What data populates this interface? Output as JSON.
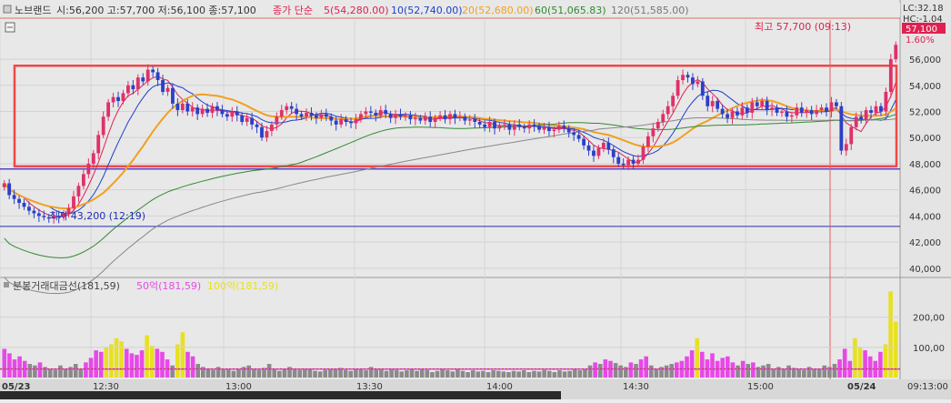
{
  "header": {
    "stock_name": "노브랜드",
    "ohlc_text": "시:56,200 고:57,700 저:56,100 종:57,100",
    "ma_title": "종가 단순",
    "ma5": "5(54,280.00)",
    "ma10": "10(52,740.00)",
    "ma20": "20(52,680.00)",
    "ma60": "60(51,065.83)",
    "ma120": "120(51,585.00)"
  },
  "side_labels": {
    "lc": "LC:32.18",
    "hc": "HC:-1.04",
    "last_price": "57,100",
    "change_pct": "1.60%"
  },
  "annotations": {
    "high": "최고 57,700 (09:13)",
    "low": "최저 43,200 (12:19)"
  },
  "volume_header": {
    "title": "분봉거래대금선(181,59)",
    "ma50": "50억(181,59)",
    "ma100": "100억(181,59)"
  },
  "time_axis": {
    "labels": [
      "05/23",
      "12:30",
      "13:00",
      "13:30",
      "14:00",
      "14:30",
      "15:00",
      "05/24"
    ],
    "right_label": "09:13:00"
  },
  "colors": {
    "up": "#e0306a",
    "down": "#2a40c8",
    "ma5": "#e02050",
    "ma10": "#2040c8",
    "ma20": "#f0a020",
    "ma60": "#308a30",
    "ma120": "#888888",
    "box": "#f04848",
    "support": "#6040c0",
    "low_line": "#2030b0",
    "vol_up": "#e8e020",
    "vol_spike": "#e848e8",
    "vol_base": "#8a8a8a"
  },
  "chart_data": [
    {
      "type": "candlestick",
      "title": "",
      "ylim": [
        39500,
        59000
      ],
      "y_ticks": [
        40000,
        42000,
        44000,
        46000,
        48000,
        50000,
        52000,
        54000,
        56000
      ],
      "y_tick_labels": [
        "40,000",
        "42,000",
        "44,000",
        "46,000",
        "48,000",
        "50,000",
        "52,000",
        "54,000",
        "56,000"
      ],
      "close_series": [
        46500,
        45600,
        45300,
        45000,
        44700,
        44400,
        44200,
        44000,
        43900,
        43800,
        44000,
        43900,
        44200,
        44600,
        45500,
        46300,
        47200,
        48000,
        48800,
        50200,
        51600,
        52700,
        53100,
        52800,
        53400,
        54000,
        53700,
        54600,
        54300,
        55200,
        55000,
        54400,
        53500,
        53800,
        52600,
        52100,
        52600,
        52000,
        52300,
        51800,
        52200,
        51900,
        52400,
        52100,
        51800,
        51600,
        52000,
        51700,
        51200,
        51500,
        51000,
        50800,
        50000,
        50500,
        51000,
        51600,
        52100,
        52400,
        52200,
        51800,
        51600,
        51900,
        51700,
        51500,
        51800,
        51600,
        51300,
        51000,
        51400,
        51200,
        51100,
        51400,
        51800,
        52000,
        51900,
        51700,
        52100,
        51800,
        51500,
        51800,
        51600,
        51700,
        51400,
        51500,
        51300,
        51600,
        51200,
        51500,
        51700,
        51400,
        51800,
        51500,
        51600,
        51300,
        51400,
        51200,
        51000,
        50800,
        51200,
        50700,
        50900,
        51000,
        50600,
        51000,
        50800,
        50700,
        51000,
        50900,
        50600,
        50800,
        50500,
        50600,
        50900,
        50700,
        50400,
        50200,
        49900,
        49400,
        49000,
        48600,
        49200,
        49600,
        49100,
        48500,
        48000,
        47900,
        48300,
        48000,
        48300,
        49300,
        50100,
        50700,
        51200,
        51800,
        52400,
        53200,
        54400,
        54800,
        54600,
        54100,
        54300,
        53200,
        52400,
        52800,
        52200,
        51800,
        51500,
        52000,
        51700,
        52300,
        51900,
        52700,
        52400,
        52800,
        52100,
        52300,
        51900,
        52000,
        51600,
        51700,
        52300,
        51900,
        52100,
        51800,
        52100,
        52300,
        52000,
        52700,
        52400,
        49000,
        49500,
        50800,
        51600,
        51400,
        52100,
        51900,
        52400,
        52000,
        53500,
        56000,
        57100
      ],
      "ma_series": [
        {
          "name": "5",
          "values": [
            53000,
            53200,
            51800,
            51600,
            51700,
            51600,
            52900,
            52900,
            52800,
            53500,
            52300,
            53900,
            54280
          ]
        },
        {
          "name": "10",
          "values": [
            52500,
            52600,
            52300,
            52100,
            52000,
            51900,
            52400,
            52500,
            52400,
            52600,
            52300,
            52500,
            52740
          ]
        },
        {
          "name": "20",
          "values": [
            52300,
            52400,
            52300,
            52200,
            52100,
            52000,
            52200,
            52300,
            52300,
            52400,
            52400,
            52500,
            52680
          ]
        },
        {
          "name": "60",
          "values": [
            51000,
            51100,
            51200,
            51200,
            51100,
            51100,
            51100,
            51000,
            51000,
            51000,
            51000,
            51000,
            51065.83
          ]
        },
        {
          "name": "120",
          "values": [
            51400,
            51450,
            51450,
            51500,
            51500,
            51500,
            51500,
            51500,
            51550,
            51550,
            51550,
            51560,
            51585
          ]
        }
      ],
      "high": 57700,
      "low": 43200,
      "box_range": [
        47800,
        55500
      ],
      "support_level": 47600,
      "low_level": 43200
    },
    {
      "type": "bar",
      "title": "",
      "ylim": [
        0,
        280
      ],
      "y_ticks": [
        100,
        200
      ],
      "y_tick_labels": [
        "100,00",
        "200,00"
      ],
      "values": [
        95,
        80,
        60,
        70,
        55,
        45,
        40,
        50,
        35,
        30,
        25,
        40,
        30,
        35,
        45,
        30,
        50,
        65,
        90,
        85,
        100,
        110,
        130,
        120,
        95,
        80,
        75,
        90,
        140,
        105,
        95,
        85,
        60,
        40,
        110,
        150,
        85,
        70,
        45,
        35,
        30,
        25,
        35,
        30,
        28,
        22,
        30,
        35,
        40,
        28,
        25,
        32,
        45,
        30,
        22,
        28,
        35,
        30,
        25,
        28,
        30,
        22,
        20,
        25,
        28,
        30,
        32,
        25,
        22,
        30,
        28,
        24,
        35,
        26,
        28,
        22,
        30,
        25,
        20,
        24,
        28,
        22,
        30,
        25,
        18,
        22,
        28,
        24,
        20,
        26,
        22,
        18,
        24,
        20,
        22,
        18,
        24,
        22,
        20,
        18,
        22,
        20,
        24,
        18,
        22,
        20,
        25,
        22,
        18,
        24,
        20,
        22,
        26,
        24,
        30,
        40,
        50,
        45,
        60,
        55,
        48,
        40,
        35,
        50,
        45,
        60,
        70,
        40,
        30,
        35,
        40,
        45,
        50,
        55,
        70,
        90,
        130,
        85,
        60,
        80,
        55,
        65,
        70,
        50,
        40,
        55,
        45,
        50,
        35,
        40,
        45,
        30,
        35,
        28,
        40,
        32,
        30,
        25,
        35,
        30,
        28,
        40,
        35,
        45,
        60,
        95,
        55,
        130,
        100,
        90,
        70,
        55,
        85,
        110,
        285,
        185
      ]
    }
  ]
}
